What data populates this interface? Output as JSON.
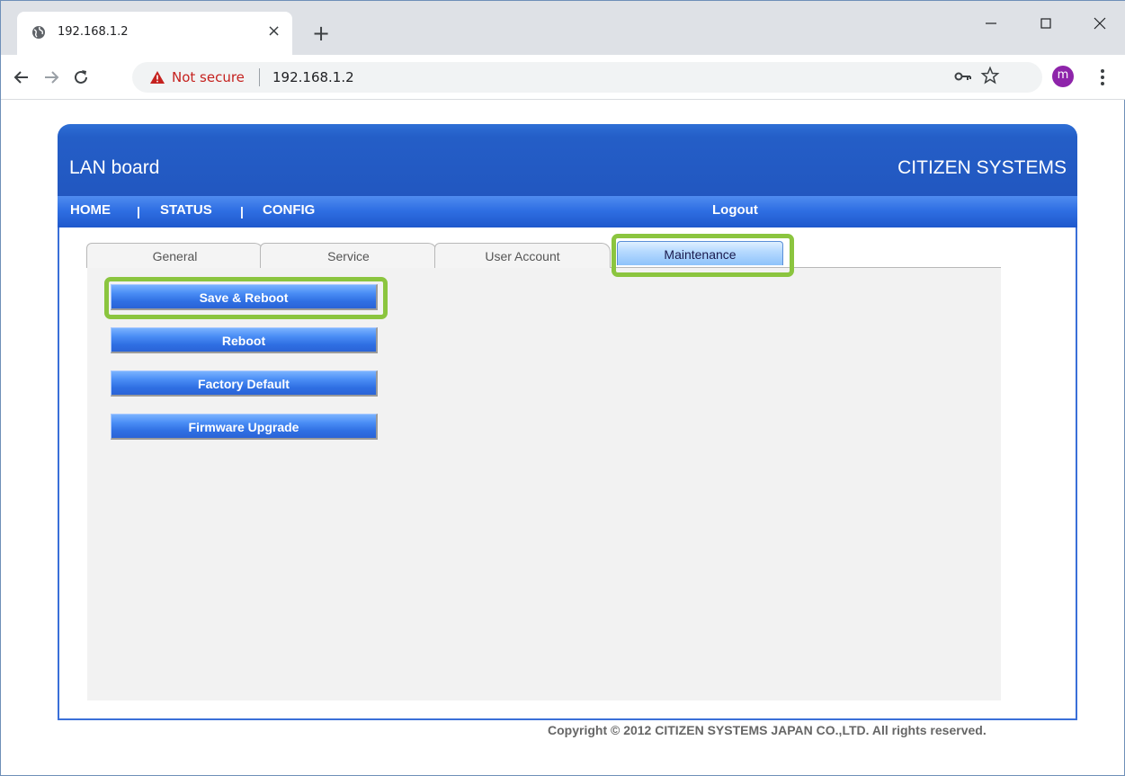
{
  "browser": {
    "tab_title": "192.168.1.2",
    "tab_close": "×",
    "new_tab": "+",
    "security_label": "Not secure",
    "url": "192.168.1.2",
    "profile_initial": "m"
  },
  "header": {
    "app_title": "LAN board",
    "brand": "CITIZEN SYSTEMS"
  },
  "nav": {
    "items": [
      "HOME",
      "STATUS",
      "CONFIG"
    ],
    "separator": "|",
    "logout": "Logout"
  },
  "tabs": [
    {
      "label": "General",
      "active": false
    },
    {
      "label": "Service",
      "active": false
    },
    {
      "label": "User Account",
      "active": false
    },
    {
      "label": "Maintenance",
      "active": true
    }
  ],
  "actions": [
    {
      "label": "Save & Reboot",
      "highlighted": true
    },
    {
      "label": "Reboot",
      "highlighted": false
    },
    {
      "label": "Factory Default",
      "highlighted": false
    },
    {
      "label": "Firmware Upgrade",
      "highlighted": false
    }
  ],
  "footer": {
    "copyright": "Copyright © 2012 CITIZEN SYSTEMS JAPAN CO.,LTD. All rights reserved."
  },
  "colors": {
    "header_blue": "#2257c0",
    "button_blue": "#2f6fe3",
    "highlight_green": "#8bc53f",
    "insecure_red": "#c5221f",
    "avatar_purple": "#8e24aa"
  }
}
